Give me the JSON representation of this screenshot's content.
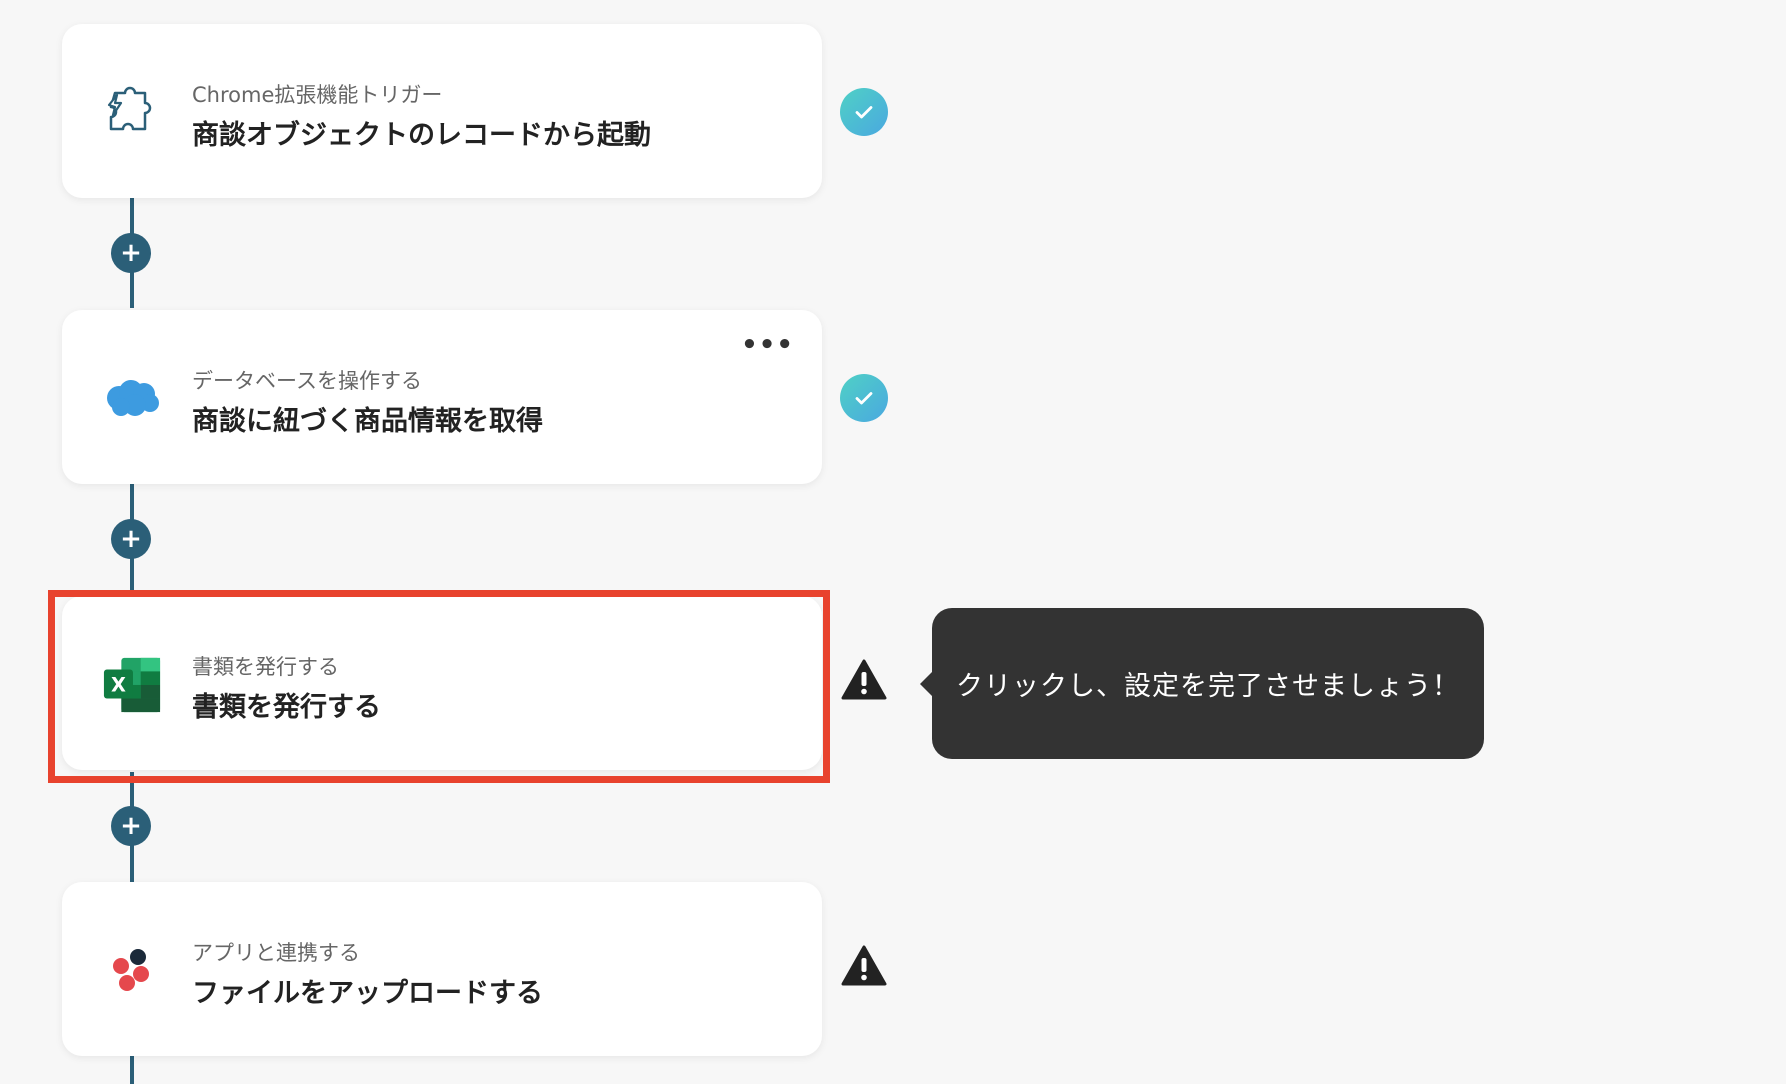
{
  "steps": [
    {
      "subtitle": "Chrome拡張機能トリガー",
      "title": "商談オブジェクトのレコードから起動",
      "icon": "puzzle-lightning-icon",
      "status": "complete"
    },
    {
      "subtitle": "データベースを操作する",
      "title": "商談に紐づく商品情報を取得",
      "icon": "salesforce-cloud-icon",
      "status": "complete",
      "more": "•••"
    },
    {
      "subtitle": "書類を発行する",
      "title": "書類を発行する",
      "icon": "excel-icon",
      "status": "warning"
    },
    {
      "subtitle": "アプリと連携する",
      "title": "ファイルをアップロードする",
      "icon": "app-logo-icon",
      "status": "warning"
    }
  ],
  "add_step_label": "+",
  "tooltip": {
    "text": "クリックし、設定を完了させましょう！"
  },
  "colors": {
    "connector": "#2b5f78",
    "highlight": "#e8432e",
    "tooltip_bg": "#333333",
    "check": "#4fc3d6"
  }
}
